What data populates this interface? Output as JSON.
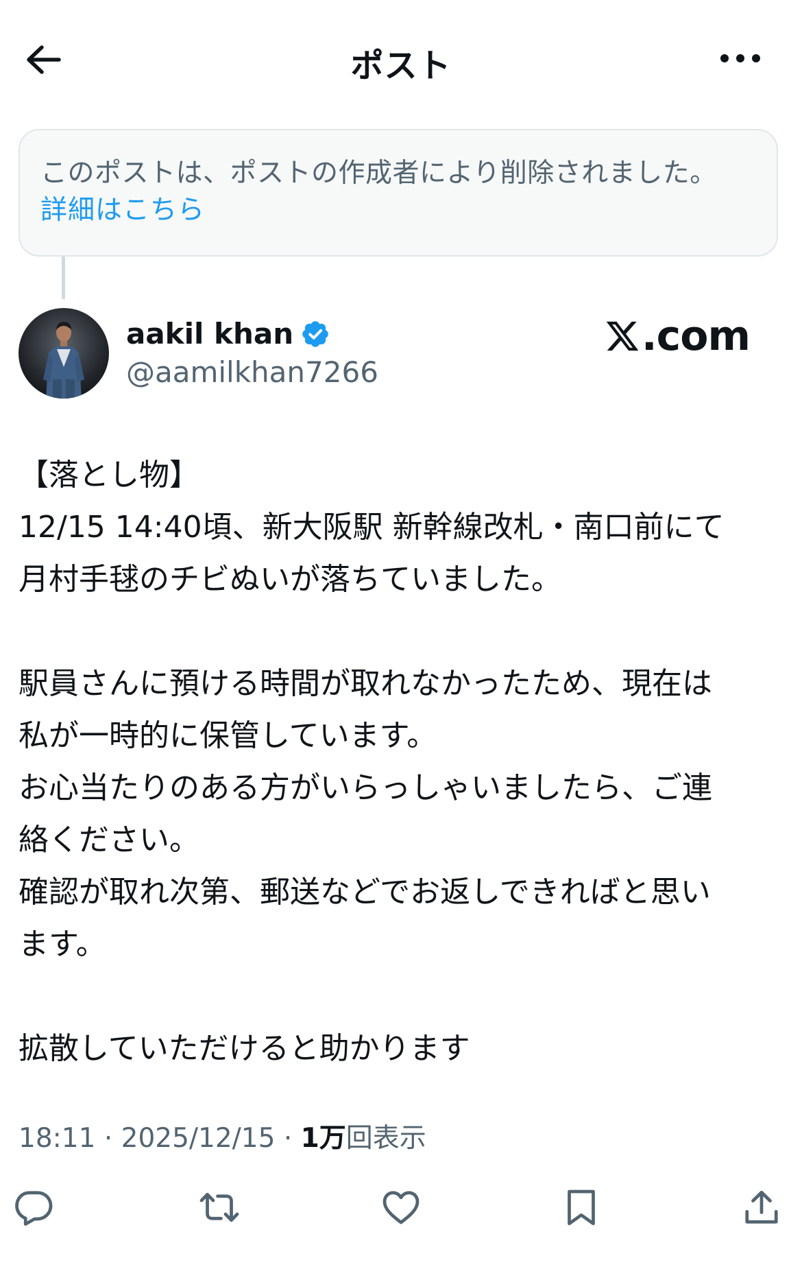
{
  "header": {
    "title": "ポスト"
  },
  "notice": {
    "text": "このポストは、ポストの作成者により削除されました。",
    "link": "詳細はこちら"
  },
  "author": {
    "display_name": "aakil khan",
    "handle": "@aamilkhan7266",
    "verified": true
  },
  "badge": {
    "text": ".com"
  },
  "post": {
    "lines": [
      "【落とし物】",
      "12/15 14:40頃、新大阪駅 新幹線改札・南口前にて",
      "月村手毬のチビぬいが落ちていました。",
      "",
      "駅員さんに預ける時間が取れなかったため、現在は",
      "私が一時的に保管しています。",
      "お心当たりのある方がいらっしゃいましたら、ご連",
      "絡ください。",
      "確認が取れ次第、郵送などでお返しできればと思い",
      "ます。",
      "",
      "拡散していただけると助かります"
    ]
  },
  "meta": {
    "time": "18:11",
    "separator": "·",
    "date": "2025/12/15",
    "views_count": "1万",
    "views_label": "回表示"
  },
  "colors": {
    "accent": "#1d9bf0",
    "text": "#0f1419",
    "secondary": "#536471",
    "notice_bg": "#f7f9f9",
    "border": "#e1e6ea"
  },
  "icons": {
    "back": "arrow-left-icon",
    "more": "more-horizontal-icon",
    "reply": "reply-icon",
    "repost": "repost-icon",
    "like": "heart-icon",
    "bookmark": "bookmark-icon",
    "share": "share-icon"
  }
}
